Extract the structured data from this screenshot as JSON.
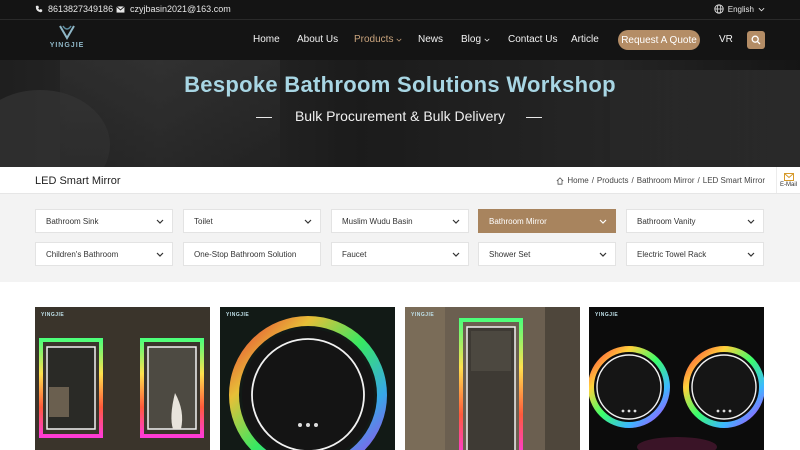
{
  "topbar": {
    "phone": "8613827349186",
    "email": "czyjbasin2021@163.com",
    "language": "English"
  },
  "logo": {
    "text": "YINGJIE"
  },
  "nav": {
    "items": [
      {
        "label": "Home"
      },
      {
        "label": "About Us"
      },
      {
        "label": "Products"
      },
      {
        "label": "News"
      },
      {
        "label": "Blog"
      },
      {
        "label": "Contact Us"
      },
      {
        "label": "Article"
      }
    ],
    "quote_label": "Request A Quote",
    "vr_label": "VR"
  },
  "hero": {
    "title": "Bespoke Bathroom Solutions Workshop",
    "subtitle": "Bulk Procurement & Bulk Delivery"
  },
  "page": {
    "title": "LED Smart Mirror",
    "breadcrumb": [
      "Home",
      "Products",
      "Bathroom Mirror",
      "LED Smart Mirror"
    ],
    "email_side_label": "E-Mail"
  },
  "filters": [
    {
      "label": "Bathroom Sink"
    },
    {
      "label": "Toilet"
    },
    {
      "label": "Muslim Wudu Basin"
    },
    {
      "label": "Bathroom Mirror"
    },
    {
      "label": "Bathroom Vanity"
    },
    {
      "label": "Children's Bathroom"
    },
    {
      "label": "One-Stop Bathroom Solution"
    },
    {
      "label": "Faucet"
    },
    {
      "label": "Shower Set"
    },
    {
      "label": "Electric Towel Rack"
    }
  ],
  "products": [
    {
      "brand": "YINGJIE"
    },
    {
      "brand": "YINGJIE"
    },
    {
      "brand": "YINGJIE"
    },
    {
      "brand": "YINGJIE"
    }
  ],
  "colors": {
    "accent": "#b48d66",
    "active_filter": "#a8845e",
    "hero_title": "#a8d6e4",
    "header_bg": "#141414"
  }
}
